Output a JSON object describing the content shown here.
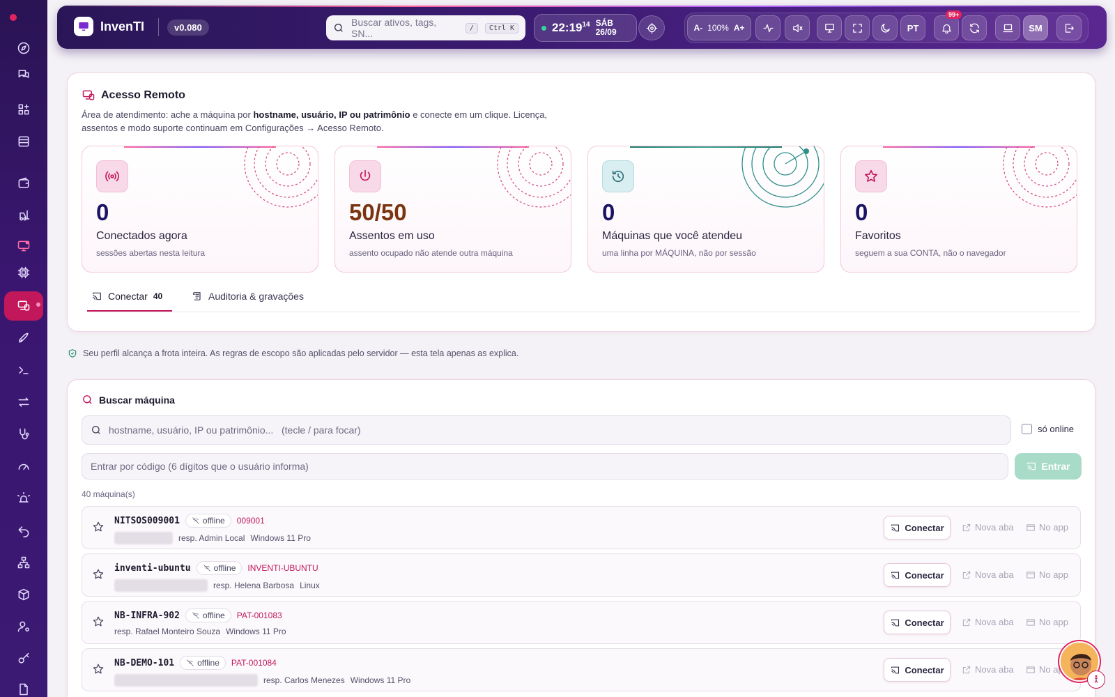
{
  "colors": {
    "accent": "#c2185b",
    "sidebar": "#3a1670",
    "topbar": "#2a1657",
    "enter_button": "#a8dcc8",
    "card_value": "#1b1464",
    "card_value_highlight": "#7a3510"
  },
  "sidebar": {
    "items": [
      {
        "icon": "compass-icon"
      },
      {
        "icon": "chat-icon"
      },
      {
        "icon": "grid-plus-icon"
      },
      {
        "icon": "server-icon"
      },
      {
        "icon": "wallet-icon"
      },
      {
        "icon": "forklift-icon"
      },
      {
        "icon": "monitor-alert-icon"
      },
      {
        "icon": "cpu-icon"
      },
      {
        "icon": "remote-desktop-icon",
        "active": true
      },
      {
        "icon": "rocket-icon"
      },
      {
        "icon": "terminal-icon"
      },
      {
        "icon": "transfer-icon"
      },
      {
        "icon": "stethoscope-icon"
      },
      {
        "icon": "gauge-icon"
      },
      {
        "icon": "alarm-icon"
      },
      {
        "icon": "undo-icon"
      },
      {
        "icon": "network-icon"
      },
      {
        "icon": "package-icon"
      },
      {
        "icon": "user-settings-icon"
      },
      {
        "icon": "key-icon"
      },
      {
        "icon": "file-icon"
      }
    ]
  },
  "topbar": {
    "app_name": "InvenTI",
    "version": "v0.080",
    "search_placeholder": "Buscar ativos, tags, SN...",
    "search_kbd_slash": "/",
    "search_kbd_ctrlk": "Ctrl K",
    "clock_hm": "22:19",
    "clock_sec": "14",
    "clock_day": "SÁB",
    "clock_date": "26/09",
    "font_decrease": "A-",
    "zoom": "100%",
    "font_increase": "A+",
    "language": "PT",
    "notifications_badge": "99+",
    "user_initials": "SM"
  },
  "page": {
    "title": "Acesso Remoto",
    "desc_1": "Área de atendimento: ache a máquina por ",
    "desc_bold": "hostname, usuário, IP ou patrimônio",
    "desc_2": " e conecte em um clique. Licença, assentos e modo suporte continuam em Configurações → Acesso Remoto."
  },
  "stats": [
    {
      "icon": "broadcast-icon",
      "value": "0",
      "label": "Conectados agora",
      "sub": "sessões abertas nesta leitura"
    },
    {
      "icon": "power-icon",
      "value": "50/50",
      "label": "Assentos em uso",
      "sub": "assento ocupado não atende outra máquina"
    },
    {
      "icon": "history-icon",
      "value": "0",
      "label": "Máquinas que você atendeu",
      "sub": "uma linha por MÁQUINA, não por sessão"
    },
    {
      "icon": "star-icon",
      "value": "0",
      "label": "Favoritos",
      "sub": "seguem a sua CONTA, não o navegador"
    }
  ],
  "tabs": [
    {
      "label": "Conectar",
      "count": "40",
      "active": true
    },
    {
      "label": "Auditoria & gravações"
    }
  ],
  "scope_note": "Seu perfil alcança a frota inteira. As regras de escopo são aplicadas pelo servidor — esta tela apenas as explica.",
  "search": {
    "title": "Buscar máquina",
    "placeholder": "hostname, usuário, IP ou patrimônio...   (tecle / para focar)",
    "only_online": "só online",
    "code_placeholder": "Entrar por código (6 dígitos que o usuário informa)",
    "enter_button": "Entrar",
    "count_label": "40 máquina(s)"
  },
  "row_actions": {
    "connect": "Conectar",
    "new_tab": "Nova aba",
    "in_app": "No app"
  },
  "machines": [
    {
      "hostname": "NITSOS009001",
      "status": "offline",
      "tag": "009001",
      "owner": "resp. Admin Local",
      "os": "Windows 11 Pro"
    },
    {
      "hostname": "inventi-ubuntu",
      "status": "offline",
      "tag": "INVENTI-UBUNTU",
      "owner": "resp. Helena Barbosa",
      "os": "Linux"
    },
    {
      "hostname": "NB-INFRA-902",
      "status": "offline",
      "tag": "PAT-001083",
      "owner": "resp. Rafael Monteiro Souza",
      "os": "Windows 11 Pro"
    },
    {
      "hostname": "NB-DEMO-101",
      "status": "offline",
      "tag": "PAT-001084",
      "owner": "resp. Carlos Menezes",
      "os": "Windows 11 Pro"
    }
  ]
}
